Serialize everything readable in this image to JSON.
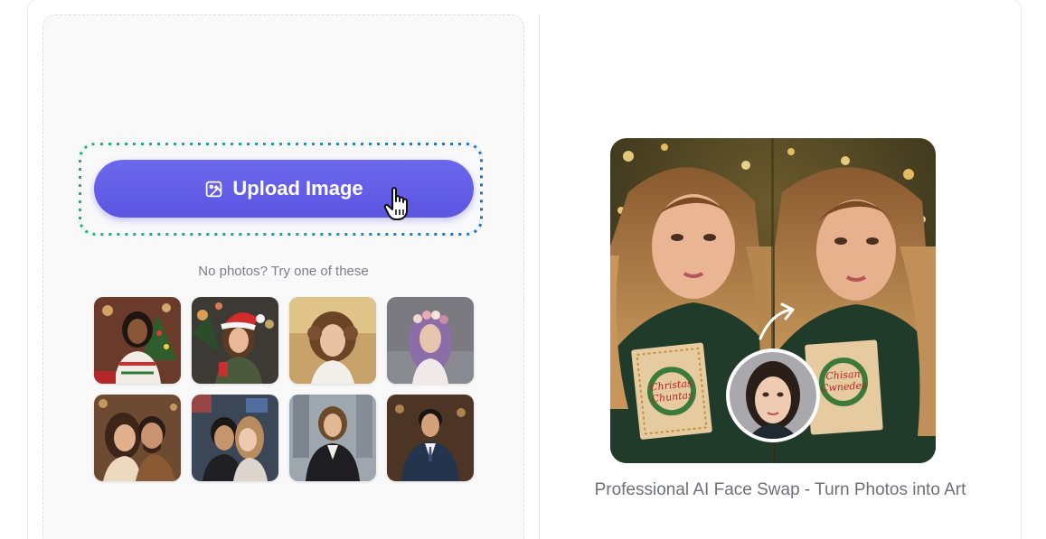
{
  "upload": {
    "button_label": "Upload Image",
    "button_icon": "image-upload-icon",
    "hint": "No photos? Try one of these"
  },
  "samples": [
    {
      "name": "sample-christmas-sweater"
    },
    {
      "name": "sample-santa-hat"
    },
    {
      "name": "sample-short-hair"
    },
    {
      "name": "sample-flower-crown"
    },
    {
      "name": "sample-couple-selfie"
    },
    {
      "name": "sample-couple-city"
    },
    {
      "name": "sample-businesswoman"
    },
    {
      "name": "sample-businessman"
    }
  ],
  "example": {
    "caption": "Professional AI Face Swap - Turn Photos into Art",
    "card_text_left": [
      "Christas",
      "Chuntas"
    ],
    "card_text_right": [
      "Chisan",
      "Cwnedes"
    ]
  },
  "colors": {
    "accent": "#5f5ae6",
    "dashed_start": "#1fb37a",
    "dashed_end": "#1670d6"
  }
}
